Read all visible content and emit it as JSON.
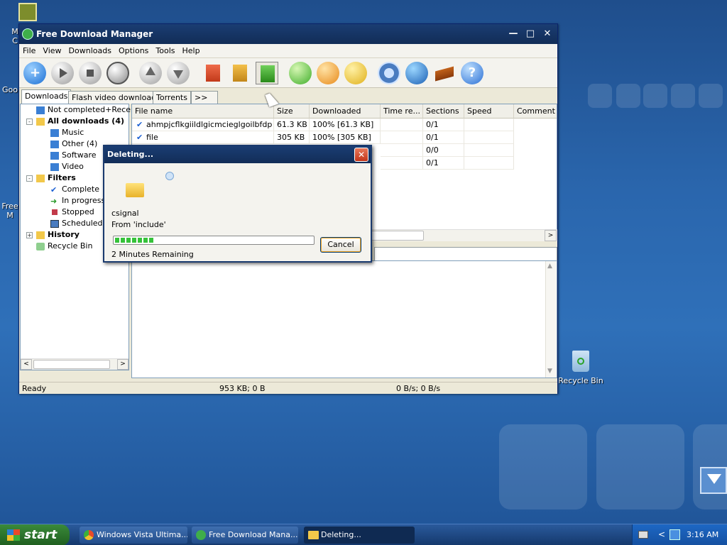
{
  "desktop": {
    "icons": [
      {
        "label": "Recycle Bin"
      },
      {
        "label": "M\nC"
      },
      {
        "label": "Goo"
      },
      {
        "label": "Free\nM"
      }
    ]
  },
  "window": {
    "title": "Free Download Manager",
    "menu": [
      "File",
      "View",
      "Downloads",
      "Options",
      "Tools",
      "Help"
    ],
    "toolbar_icons": [
      "add-download-icon",
      "start-icon",
      "stop-icon",
      "schedule-icon",
      "move-up-icon",
      "move-down-icon",
      "start-all-icon",
      "stop-all-icon",
      "pause-all-icon",
      "start-selected-icon",
      "stop-selected-icon",
      "pause-icon",
      "settings-icon",
      "music-icon",
      "books-icon",
      "help-icon"
    ],
    "tabs": [
      "Downloads",
      "Flash video downloads",
      "Torrents",
      ">>"
    ],
    "tree": {
      "not_completed": "Not completed+Recen",
      "all_downloads": "All downloads (4)",
      "music": "Music",
      "other": "Other (4)",
      "software": "Software",
      "video": "Video",
      "filters": "Filters",
      "complete": "Complete",
      "in_progress": "In progress",
      "stopped": "Stopped",
      "scheduled": "Scheduled",
      "history": "History",
      "recycle_bin": "Recycle Bin"
    },
    "columns": [
      "File name",
      "Size",
      "Downloaded",
      "Time re...",
      "Sections",
      "Speed",
      "Comment"
    ],
    "rows": [
      {
        "name": "ahmpjcflkgiildlgicmcieglgoilbfdp",
        "size": "61.3 KB",
        "downloaded": "100% [61.3 KB]",
        "sections": "0/1"
      },
      {
        "name": "file",
        "size": "305 KB",
        "downloaded": "100% [305 KB]",
        "sections": "0/1"
      },
      {
        "name": "",
        "size": "",
        "downloaded": "",
        "sections": "0/0"
      },
      {
        "name": "",
        "size": "",
        "downloaded": "",
        "sections": "0/1"
      }
    ],
    "status": {
      "ready": "Ready",
      "sizes": "953 KB; 0 B",
      "speed": "0 B/s; 0 B/s"
    }
  },
  "dialog": {
    "title": "Deleting...",
    "file": "csignal",
    "from": "From 'include'",
    "remaining": "2 Minutes Remaining",
    "progress_percent": 20,
    "cancel": "Cancel"
  },
  "taskbar": {
    "start": "start",
    "tasks": [
      "Windows Vista Ultima...",
      "Free Download Mana...",
      "Deleting..."
    ],
    "clock": "3:16 AM"
  }
}
